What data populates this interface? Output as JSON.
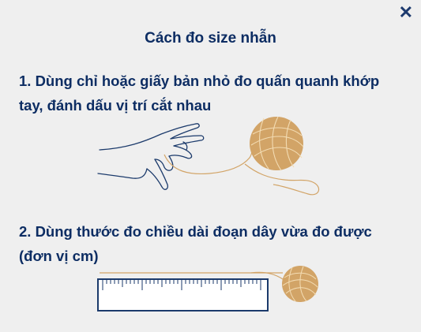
{
  "modal": {
    "title": "Cách đo size nhẫn",
    "close_glyph": "✕",
    "close_icon": "close-icon",
    "steps": [
      {
        "line1": "1. Dùng chỉ hoặc giấy bản nhỏ đo quấn quanh khớp",
        "line2": "tay, đánh dấu vị trí cắt nhau"
      },
      {
        "line1": "2. Dùng thước đo chiều dài đoạn dây vừa đo được",
        "line2": "(đơn vị cm)"
      }
    ]
  },
  "colors": {
    "text": "#0d2d63",
    "yarn": "#d2a467",
    "line": "#1b3a6b",
    "background": "#efefef"
  }
}
